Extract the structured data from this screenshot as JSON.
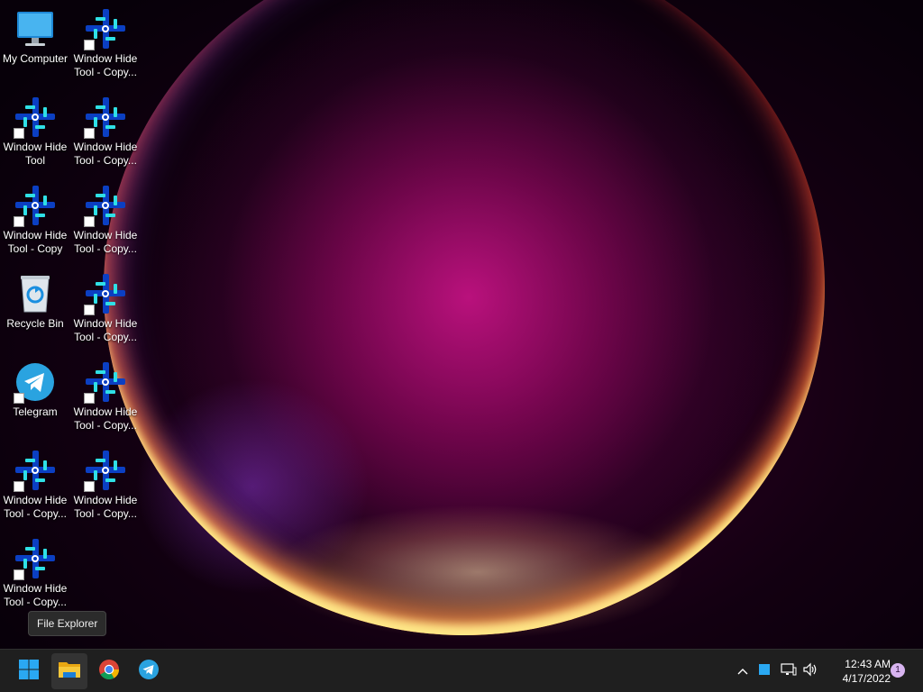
{
  "desktop": {
    "icons": [
      {
        "label": "My Computer",
        "icon": "monitor-icon"
      },
      {
        "label": "Window Hide Tool - Copy...",
        "icon": "window-hide-tool-icon"
      },
      {
        "label": "Window Hide Tool",
        "icon": "window-hide-tool-icon"
      },
      {
        "label": "Window Hide Tool - Copy...",
        "icon": "window-hide-tool-icon"
      },
      {
        "label": "Window Hide Tool - Copy",
        "icon": "window-hide-tool-icon"
      },
      {
        "label": "Window Hide Tool - Copy...",
        "icon": "window-hide-tool-icon"
      },
      {
        "label": "Recycle Bin",
        "icon": "recycle-bin-icon"
      },
      {
        "label": "Window Hide Tool - Copy...",
        "icon": "window-hide-tool-icon"
      },
      {
        "label": "Telegram",
        "icon": "telegram-icon"
      },
      {
        "label": "Window Hide Tool - Copy...",
        "icon": "window-hide-tool-icon"
      },
      {
        "label": "Window Hide Tool - Copy...",
        "icon": "window-hide-tool-icon"
      },
      {
        "label": "Window Hide Tool - Copy...",
        "icon": "window-hide-tool-icon"
      },
      {
        "label": "Window Hide Tool - Copy...",
        "icon": "window-hide-tool-icon"
      }
    ]
  },
  "tooltip": {
    "text": "File Explorer"
  },
  "taskbar": {
    "apps": [
      {
        "name": "Start",
        "icon": "windows-start-icon"
      },
      {
        "name": "File Explorer",
        "icon": "folder-icon"
      },
      {
        "name": "Google Chrome",
        "icon": "chrome-icon"
      },
      {
        "name": "Telegram",
        "icon": "telegram-icon"
      }
    ],
    "tray": {
      "icons": [
        "chevron-up-icon",
        "app-tray-icon",
        "network-icon",
        "volume-icon"
      ],
      "time": "12:43 AM",
      "date": "4/17/2022",
      "notification_count": "1"
    }
  },
  "colors": {
    "taskbar_bg": "#1f1f1f",
    "accent": "#0078d4",
    "telegram_blue": "#2aa3e0"
  }
}
